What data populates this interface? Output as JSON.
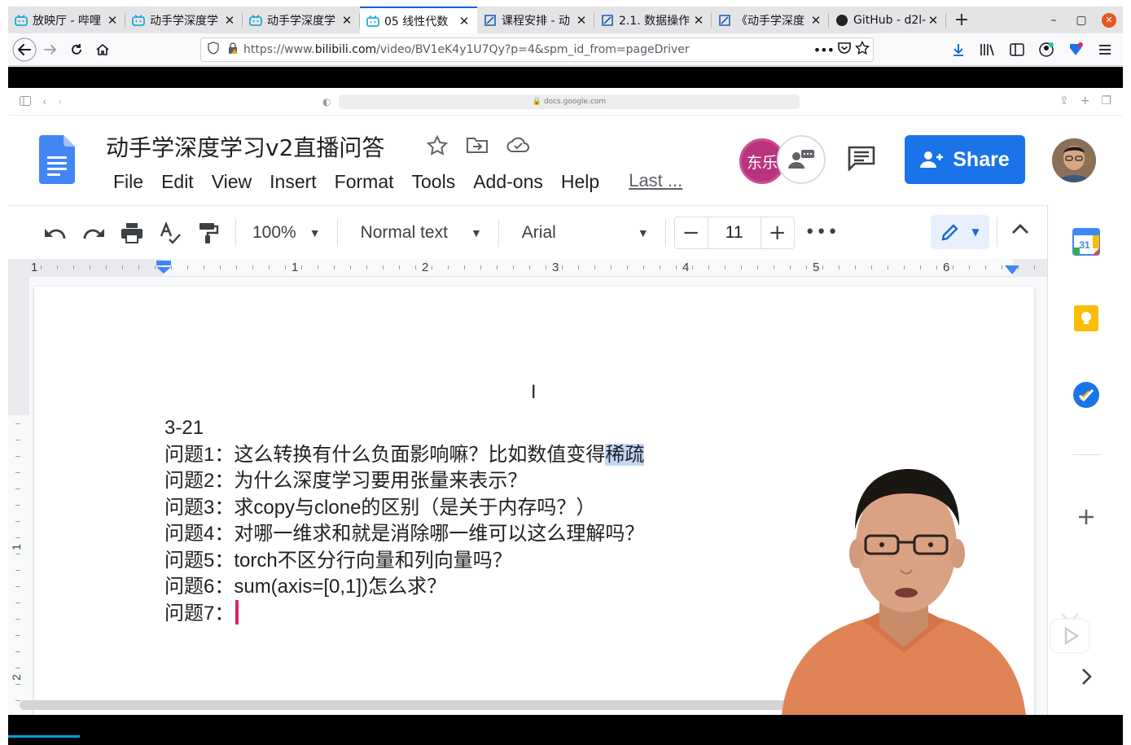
{
  "browser": {
    "tabs": [
      {
        "title": "放映厅 - 哔哩",
        "icon": "bilibili-icon",
        "active": false
      },
      {
        "title": "动手学深度学",
        "icon": "bilibili-icon",
        "active": false
      },
      {
        "title": "动手学深度学",
        "icon": "bilibili-icon",
        "active": false
      },
      {
        "title": "05 线性代数",
        "icon": "bilibili-icon",
        "active": true
      },
      {
        "title": "课程安排 - 动",
        "icon": "d2l-icon",
        "active": false
      },
      {
        "title": "2.1. 数据操作",
        "icon": "d2l-icon",
        "active": false
      },
      {
        "title": "《动手学深度",
        "icon": "d2l-icon",
        "active": false
      },
      {
        "title": "GitHub - d2l-",
        "icon": "github-icon",
        "active": false
      }
    ],
    "url_prefix": "https://www.",
    "url_domain": "bilibili.com",
    "url_path": "/video/BV1eK4y1U7Qy?p=4&spm_id_from=pageDriver"
  },
  "inner_browser": {
    "address": "docs.google.com"
  },
  "docs": {
    "title": "动手学深度学习v2直播问答",
    "menu": [
      "File",
      "Edit",
      "View",
      "Insert",
      "Format",
      "Tools",
      "Add-ons",
      "Help"
    ],
    "last_edit": "Last ...",
    "collaborator_label": "东乐",
    "share_label": "Share",
    "toolbar": {
      "zoom": "100%",
      "style": "Normal text",
      "font": "Arial",
      "font_size": "11"
    },
    "ruler_numbers": [
      "1",
      "1",
      "2",
      "3",
      "4",
      "5",
      "6"
    ],
    "vruler_numbers": [
      "1",
      "2"
    ],
    "calendar_day": "31"
  },
  "document": {
    "date": "3-21",
    "q1_prefix": "问题1：这么转换有什么负面影响嘛？比如数值变得",
    "q1_highlight": "稀疏",
    "q2": "问题2：为什么深度学习要用张量来表示？",
    "q3": "问题3：求copy与clone的区别（是关于内存吗？）",
    "q4": "问题4：对哪一维求和就是消除哪一维可以这么理解吗？",
    "q5": "问题5：torch不区分行向量和列向量吗？",
    "q6": "问题6：sum(axis=[0,1])怎么求？",
    "q7": "问题7："
  },
  "colors": {
    "accent": "#1a73e8",
    "tab_active_line": "#0060df",
    "highlight": "#c2d7f5",
    "caret": "#e0245e"
  }
}
